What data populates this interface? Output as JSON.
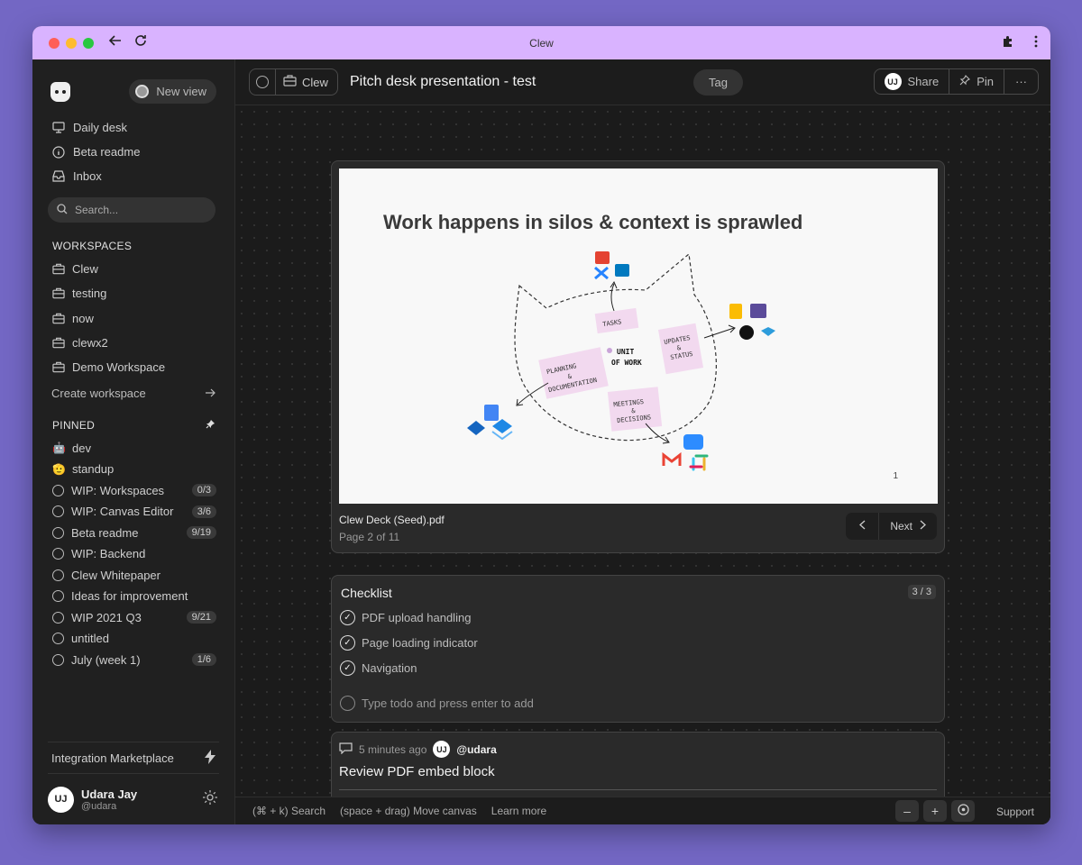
{
  "window": {
    "title": "Clew"
  },
  "sidebar": {
    "new_view": "New view",
    "nav": [
      {
        "label": "Daily desk"
      },
      {
        "label": "Beta readme"
      },
      {
        "label": "Inbox"
      }
    ],
    "search_placeholder": "Search...",
    "workspaces_heading": "WORKSPACES",
    "workspaces": [
      {
        "label": "Clew"
      },
      {
        "label": "testing"
      },
      {
        "label": "now"
      },
      {
        "label": "clewx2"
      },
      {
        "label": "Demo Workspace"
      }
    ],
    "create_workspace": "Create workspace",
    "pinned_heading": "PINNED",
    "pinned": [
      {
        "label": "dev",
        "emoji": "🤖",
        "badge": ""
      },
      {
        "label": "standup",
        "emoji": "🫡",
        "badge": ""
      },
      {
        "label": "WIP: Workspaces",
        "badge": "0/3"
      },
      {
        "label": "WIP: Canvas Editor",
        "badge": "3/6"
      },
      {
        "label": "Beta readme",
        "badge": "9/19"
      },
      {
        "label": "WIP: Backend",
        "badge": ""
      },
      {
        "label": "Clew Whitepaper",
        "badge": ""
      },
      {
        "label": "Ideas for improvement",
        "badge": ""
      },
      {
        "label": "WIP 2021 Q3",
        "badge": "9/21"
      },
      {
        "label": "untitled",
        "badge": ""
      },
      {
        "label": "July (week 1)",
        "badge": "1/6"
      }
    ],
    "marketplace": "Integration Marketplace",
    "user": {
      "initials": "UJ",
      "name": "Udara Jay",
      "handle": "@udara"
    }
  },
  "topbar": {
    "breadcrumb_workspace": "Clew",
    "title": "Pitch desk presentation - test",
    "tag": "Tag",
    "share": "Share",
    "pin": "Pin",
    "more": "···",
    "avatar_initials": "UJ"
  },
  "pdf": {
    "slide_title": "Work happens in silos & context is sprawled",
    "slide_labels": {
      "tasks": "TASKS",
      "unit_of_work_1": "UNIT",
      "unit_of_work_2": "OF WORK",
      "planning_1": "PLANNING",
      "planning_2": "&",
      "planning_3": "DOCUMENTATION",
      "updates_1": "UPDATES",
      "updates_2": "&",
      "updates_3": "STATUS",
      "meetings_1": "MEETINGS",
      "meetings_2": "&",
      "meetings_3": "DECISIONS"
    },
    "slide_number": "1",
    "filename": "Clew Deck (Seed).pdf",
    "page": "Page 2 of 11",
    "next": "Next"
  },
  "checklist": {
    "title": "Checklist",
    "count": "3 / 3",
    "items": [
      {
        "label": "PDF upload handling",
        "done": true
      },
      {
        "label": "Page loading indicator",
        "done": true
      },
      {
        "label": "Navigation",
        "done": true
      }
    ],
    "placeholder": "Type todo and press enter to add"
  },
  "comment": {
    "time": "5 minutes ago",
    "avatar_initials": "UJ",
    "user": "@udara",
    "title": "Review PDF embed block"
  },
  "bottombar": {
    "hint_search": "(⌘ + k) Search",
    "hint_move": "(space + drag) Move canvas",
    "learn_more": "Learn more",
    "zoom_out": "–",
    "zoom_in": "+",
    "support": "Support"
  }
}
